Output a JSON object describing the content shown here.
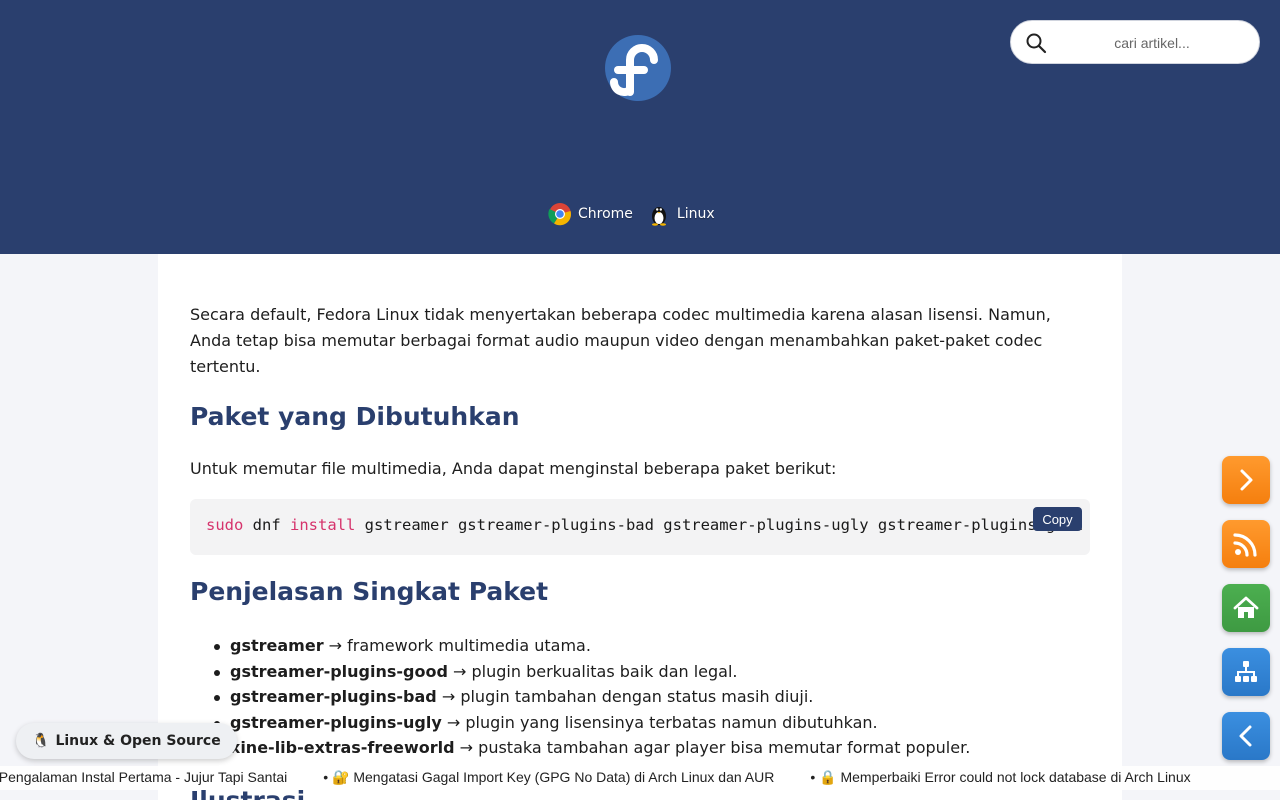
{
  "header": {
    "search": {
      "placeholder": "cari artikel..."
    },
    "tags": [
      {
        "label": "Chrome",
        "icon": "chrome-icon"
      },
      {
        "label": "Linux",
        "icon": "tux-icon"
      }
    ],
    "colors": {
      "background": "#2a3f6e"
    }
  },
  "article": {
    "intro": "Secara default, Fedora Linux tidak menyertakan beberapa codec multimedia karena alasan lisensi. Namun, Anda tetap bisa memutar berbagai format audio maupun video dengan menambahkan paket-paket codec tertentu.",
    "heading_packages": "Paket yang Dibutuhkan",
    "install_intro": "Untuk memutar file multimedia, Anda dapat menginstal beberapa paket berikut:",
    "code": {
      "cmd_sudo": "sudo",
      "cmd_dnf": " dnf ",
      "cmd_install": "install",
      "cmd_rest": " gstreamer gstreamer-plugins-bad gstreamer-plugins-ugly gstreamer-plugins-good",
      "copy_label": "Copy"
    },
    "heading_explain": "Penjelasan Singkat Paket",
    "packages": [
      {
        "name": "gstreamer",
        "desc": " → framework multimedia utama."
      },
      {
        "name": "gstreamer-plugins-good",
        "desc": " → plugin berkualitas baik dan legal."
      },
      {
        "name": "gstreamer-plugins-bad",
        "desc": " → plugin tambahan dengan status masih diuji."
      },
      {
        "name": "gstreamer-plugins-ugly",
        "desc": " → plugin yang lisensinya terbatas namun dibutuhkan."
      },
      {
        "name": "xine-lib-extras-freeworld",
        "desc": " → pustaka tambahan agar player bisa memutar format populer."
      }
    ],
    "heading_illustration": "Ilustrasi"
  },
  "floating_buttons": [
    {
      "icon": "chevron-right-icon"
    },
    {
      "icon": "rss-icon"
    },
    {
      "icon": "home-icon"
    },
    {
      "icon": "sitemap-icon"
    },
    {
      "icon": "chevron-left-icon"
    }
  ],
  "badge": {
    "emoji": "🐧",
    "label": "Linux & Open Source"
  },
  "ticker": [
    "s: Pengalaman Instal Pertama - Jujur Tapi Santai",
    "• 🔐 Mengatasi Gagal Import Key (GPG No Data) di Arch Linux dan AUR",
    "• 🔒 Memperbaiki Error could not lock database di Arch Linux"
  ]
}
